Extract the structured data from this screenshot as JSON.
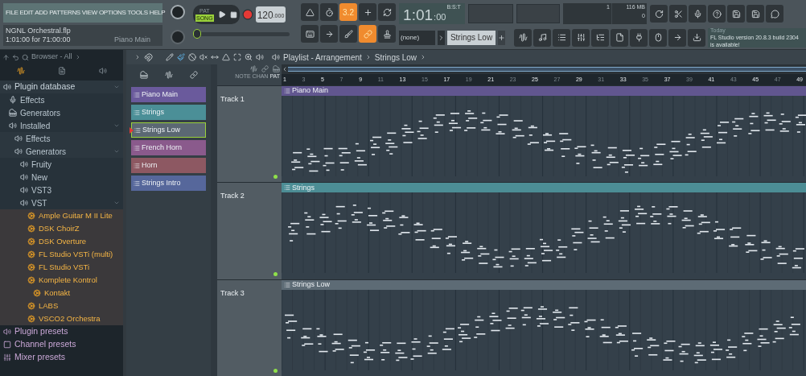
{
  "menu": [
    "FILE",
    "EDIT",
    "ADD",
    "PATTERNS",
    "VIEW",
    "OPTIONS",
    "TOOLS",
    "HELP"
  ],
  "project": {
    "name": "NGNL Orchestral.flp",
    "time": "1:01:00 for 71:00:00",
    "pattern": "Piano Main"
  },
  "transport": {
    "pat_label": "PAT",
    "song_label": "SONG",
    "song_mode": true,
    "tempo": "120",
    "tempo_fraction": ".000"
  },
  "position_slider": {
    "level": 0
  },
  "tool_buttons": [
    {
      "on": false
    },
    {
      "on": false
    },
    {
      "on": true,
      "label": "3.2"
    },
    {
      "on": false
    },
    {
      "on": false
    }
  ],
  "clock": {
    "main": "1:01",
    "small": ":00",
    "label": "B:S:T"
  },
  "monitor": {
    "cpu": "1",
    "memory": "116 MB",
    "polyphony": "0"
  },
  "edit_buttons": [
    {
      "on": false
    },
    {
      "on": false
    },
    {
      "on": false
    },
    {
      "on": true
    },
    {
      "on": false
    }
  ],
  "pattern_selector": {
    "channel": "(none)",
    "pattern": "Strings Low"
  },
  "news": {
    "date": "Today",
    "text": "FL Studio version 20.8.3 build 2304 is available!"
  },
  "browser": {
    "title": "Browser - All",
    "tree": [
      {
        "label": "Plugin database",
        "kind": "folder",
        "expanded": true,
        "children": [
          {
            "label": "Effects",
            "kind": "effect"
          },
          {
            "label": "Generators",
            "kind": "generator"
          },
          {
            "label": "Installed",
            "kind": "folder",
            "expanded": true,
            "children": [
              {
                "label": "Effects",
                "kind": "folder",
                "expanded": false
              },
              {
                "label": "Generators",
                "kind": "folder",
                "expanded": true,
                "children": [
                  {
                    "label": "Fruity",
                    "kind": "folder",
                    "expanded": false
                  },
                  {
                    "label": "New",
                    "kind": "folder",
                    "expanded": false
                  },
                  {
                    "label": "VST3",
                    "kind": "folder",
                    "expanded": false
                  },
                  {
                    "label": "VST",
                    "kind": "folder",
                    "expanded": true,
                    "children": [
                      {
                        "label": "Ample Guitar M II Lite",
                        "kind": "plugin"
                      },
                      {
                        "label": "DSK ChoirZ",
                        "kind": "plugin"
                      },
                      {
                        "label": "DSK Overture",
                        "kind": "plugin"
                      },
                      {
                        "label": "FL Studio VSTi (multi)",
                        "kind": "plugin"
                      },
                      {
                        "label": "FL Studio VSTi",
                        "kind": "plugin"
                      },
                      {
                        "label": "Komplete Kontrol",
                        "kind": "plugin",
                        "children": [
                          {
                            "label": "Kontakt",
                            "kind": "plugin"
                          }
                        ]
                      },
                      {
                        "label": "LABS",
                        "kind": "plugin"
                      },
                      {
                        "label": "VSCO2 Orchestra",
                        "kind": "plugin"
                      }
                    ]
                  }
                ]
              }
            ]
          }
        ]
      },
      {
        "label": "Plugin presets",
        "kind": "preset"
      },
      {
        "label": "Channel presets",
        "kind": "channel"
      },
      {
        "label": "Mixer presets",
        "kind": "mixer"
      }
    ]
  },
  "playlist": {
    "title": "Playlist - Arrangement",
    "pattern": "Strings Low",
    "target_labels": [
      "NOTE",
      "CHAN",
      "PAT"
    ],
    "patterns": [
      {
        "label": "Piano Main",
        "color": "#6a5a9c",
        "selected": false
      },
      {
        "label": "Strings",
        "color": "#4b8f97",
        "selected": false
      },
      {
        "label": "Strings Low",
        "color": "#5b6873",
        "selected": true
      },
      {
        "label": "French Horn",
        "color": "#8a5a8c",
        "selected": false
      },
      {
        "label": "Horn",
        "color": "#8d5862",
        "selected": false
      },
      {
        "label": "Strings Intro",
        "color": "#56679b",
        "selected": false
      }
    ],
    "ruler": [
      "1",
      "3",
      "5",
      "7",
      "9",
      "11",
      "13",
      "15",
      "17",
      "19",
      "21",
      "23",
      "25",
      "27",
      "29",
      "31",
      "33",
      "35",
      "37",
      "39",
      "41",
      "43",
      "45",
      "47",
      "49"
    ],
    "tracks": [
      {
        "name": "Track 1",
        "clip": "Piano Main",
        "color": "#61568f"
      },
      {
        "name": "Track 2",
        "clip": "Strings",
        "color": "#4c8d95"
      },
      {
        "name": "Track 3",
        "clip": "Strings Low",
        "color": "#5d6b75"
      }
    ]
  }
}
